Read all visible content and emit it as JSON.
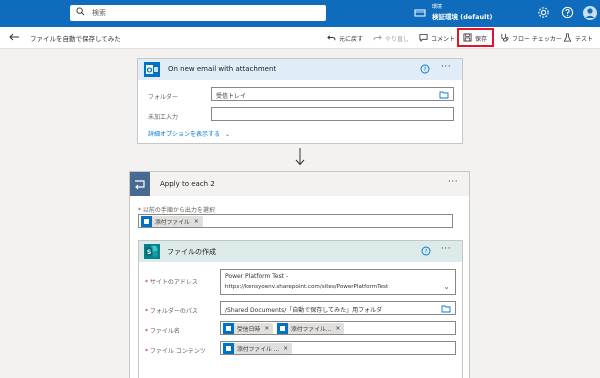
{
  "topbar": {
    "search_placeholder": "検索",
    "environment_label": "環境",
    "environment_value": "検証環境 (default)"
  },
  "cmdbar": {
    "flow_name": "ファイルを自動で保存してみた",
    "undo": "元に戻す",
    "redo": "やり直し",
    "comment": "コメント",
    "save": "保存",
    "flow_checker": "フロー チェッカー",
    "test": "テスト"
  },
  "trigger": {
    "title": "On new email with attachment",
    "folder_label": "フォルダー",
    "folder_value": "受信トレイ",
    "unread_label": "未加工入力",
    "advanced_link": "詳細オプションを表示する"
  },
  "loop": {
    "title": "Apply to each 2",
    "select_label": "以前の手順から出力を選択",
    "token": "添付ファイル"
  },
  "create_file": {
    "title": "ファイルの作成",
    "site_label": "サイトのアドレス",
    "site_value_line1": "Power Platform Test -",
    "site_value_line2": "https://kensyoenv.sharepoint.com/sites/PowerPlatformTest",
    "folder_label": "フォルダーのパス",
    "folder_value": "/Shared Documents/「自動で保存してみた」用フォルダ",
    "filename_label": "ファイル名",
    "filename_token1": "受信日時",
    "filename_token2": "添付ファイル...",
    "content_label": "ファイル コンテンツ",
    "content_token": "添付ファイル ..."
  },
  "icons": {
    "outlook_color": "#0072c6",
    "sharepoint_color": "#038387",
    "loop_color": "#486991",
    "accent": "#0f6cbd",
    "highlight_border": "#e8112d"
  }
}
